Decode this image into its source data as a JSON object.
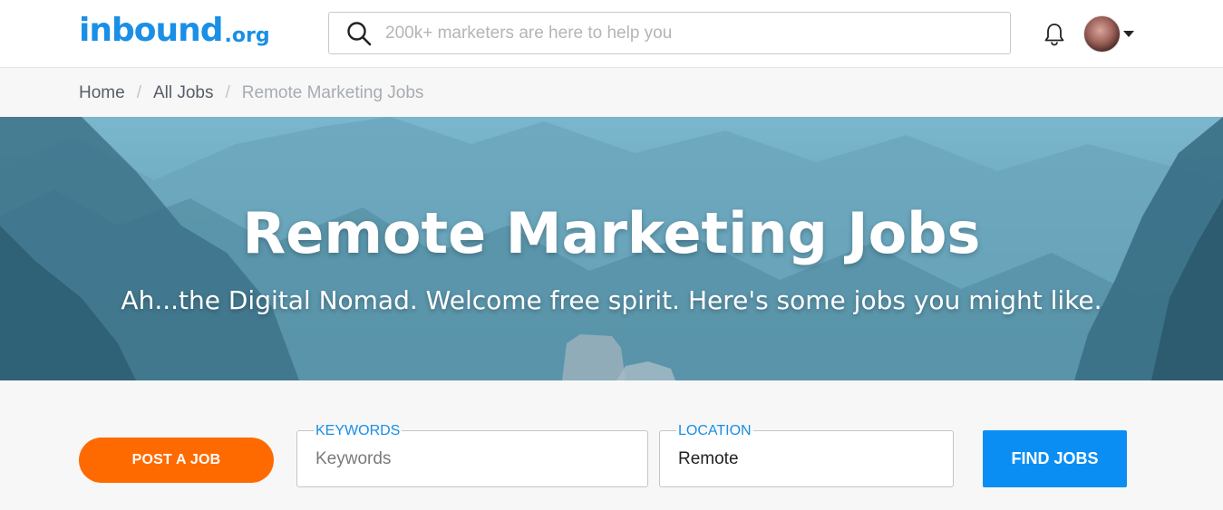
{
  "header": {
    "logo_main": "inbound",
    "logo_suffix": ".org",
    "search_placeholder": "200k+ marketers are here to help you",
    "icons": {
      "search": "search-icon",
      "notifications": "bell-icon",
      "avatar_menu": "chevron-down-icon"
    }
  },
  "breadcrumb": {
    "items": [
      "Home",
      "All Jobs"
    ],
    "current": "Remote Marketing Jobs",
    "separator": "/"
  },
  "hero": {
    "title": "Remote Marketing Jobs",
    "subtitle": "Ah...the Digital Nomad. Welcome free spirit. Here's some jobs you might like."
  },
  "filters": {
    "post_job_label": "POST A JOB",
    "keywords_label": "KEYWORDS",
    "keywords_placeholder": "Keywords",
    "keywords_value": "",
    "location_label": "LOCATION",
    "location_value": "Remote",
    "find_jobs_label": "FIND JOBS"
  },
  "colors": {
    "brand_blue": "#1a8fe6",
    "post_job_orange": "#ff6a00",
    "find_jobs_blue": "#0a8ef4"
  }
}
